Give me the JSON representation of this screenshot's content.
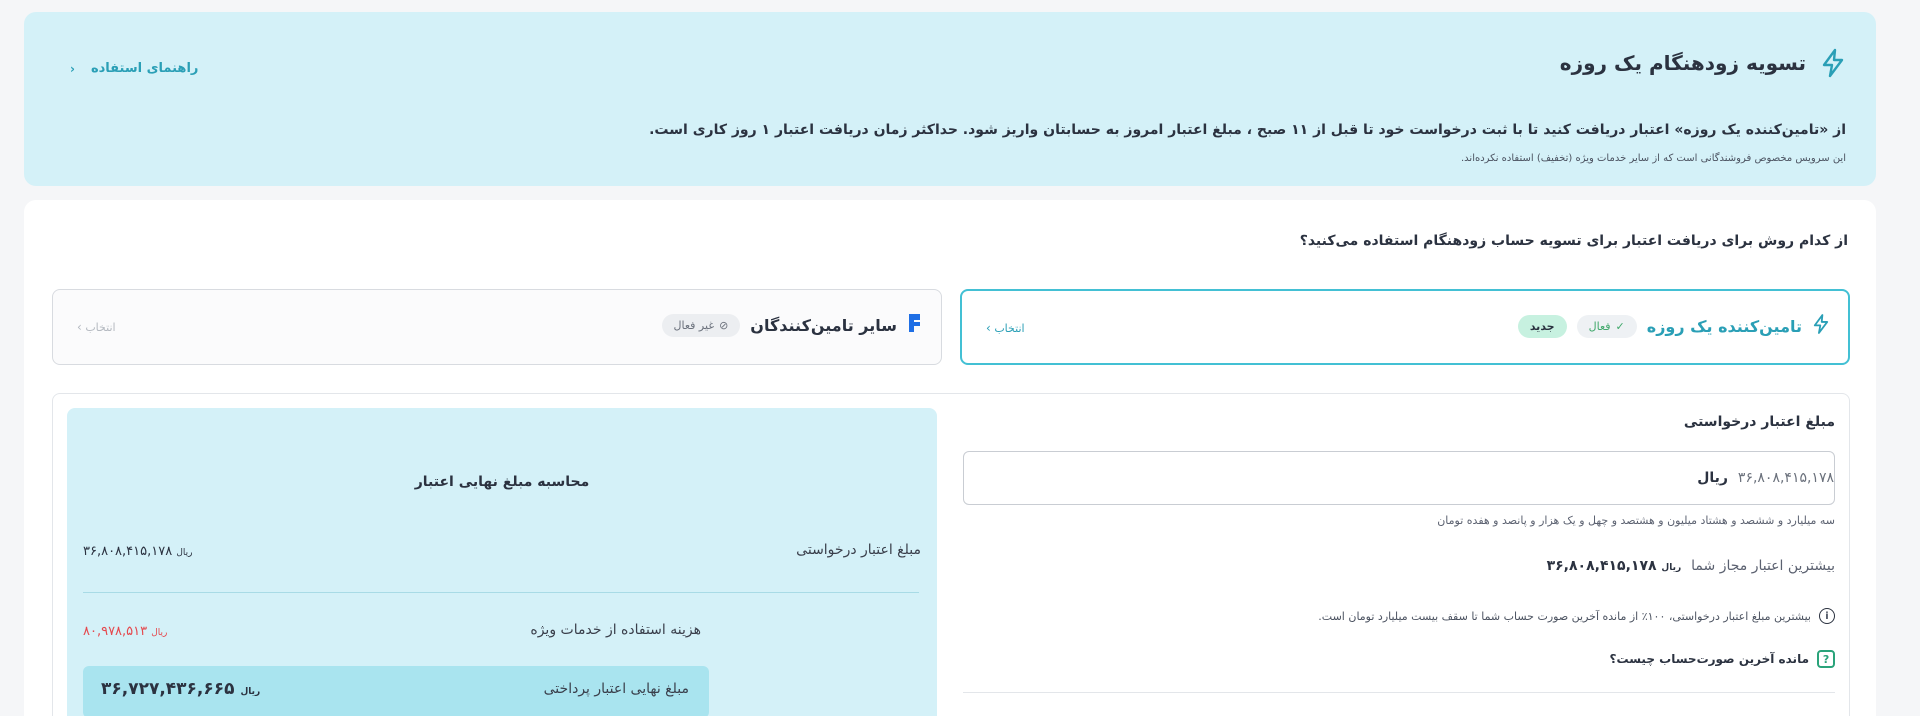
{
  "banner": {
    "title": "تسویه زودهنگام یک روزه",
    "guide_link": "راهنمای استفاده",
    "description": "از «تامین‌کننده یک روزه» اعتبار دریافت کنید تا با ثبت درخواست خود تا قبل از ۱۱ صبح ، مبلغ اعتبار امروز به حسابتان واریز شود. حداکثر زمان دریافت اعتبار ۱ روز کاری است.",
    "note": "این سرویس مخصوص فروشندگانی است که از سایر خدمات ویژه (تخفیف) استفاده نکرده‌اند.",
    "accent": "#2a9fb6"
  },
  "question": "از کدام روش برای دریافت اعتبار برای تسویه حساب زودهنگام استفاده می‌کنید؟",
  "methods": [
    {
      "name": "تامین‌کننده یک روزه",
      "status": "فعال",
      "badge": "جدید",
      "select": "انتخاب",
      "icon": "bolt-icon"
    },
    {
      "name": "سایر تامین‌کنندگان",
      "status": "غیر فعال",
      "select": "انتخاب",
      "icon": "provider-logo-icon"
    }
  ],
  "form": {
    "label": "مبلغ اعتبار درخواستی",
    "amount_value": "۳۶,۸۰۸,۴۱۵,۱۷۸",
    "amount_unit": "ریال",
    "amount_words": "سه میلیارد و ششصد و هشتاد میلیون و هشتصد و چهل و یک هزار و پانصد و هفده تومان",
    "max_label": "بیشترین اعتبار مجاز شما",
    "max_value": "۳۶,۸۰۸,۴۱۵,۱۷۸",
    "max_unit": "ریال",
    "info": "بیشترین مبلغ اعتبار درخواستی، ۱۰۰٪ از مانده آخرین صورت حساب شما تا سقف بیست میلیارد تومان است.",
    "help": "مانده آخرین صورت‌حساب چیست؟"
  },
  "calc": {
    "title": "محاسبه مبلغ نهایی اعتبار",
    "requested_label": "مبلغ اعتبار درخواستی",
    "requested_value": "۳۶,۸۰۸,۴۱۵,۱۷۸",
    "requested_unit": "ریال",
    "fee_label": "هزینه استفاده از خدمات ویژه",
    "fee_value": "۸۰,۹۷۸,۵۱۳",
    "fee_unit": "ریال",
    "final_label": "مبلغ نهایی اعتبار پرداختی",
    "final_value": "۳۶,۷۲۷,۴۳۶,۶۶۵",
    "final_unit": "ریال",
    "fee_color": "#e5484d"
  }
}
